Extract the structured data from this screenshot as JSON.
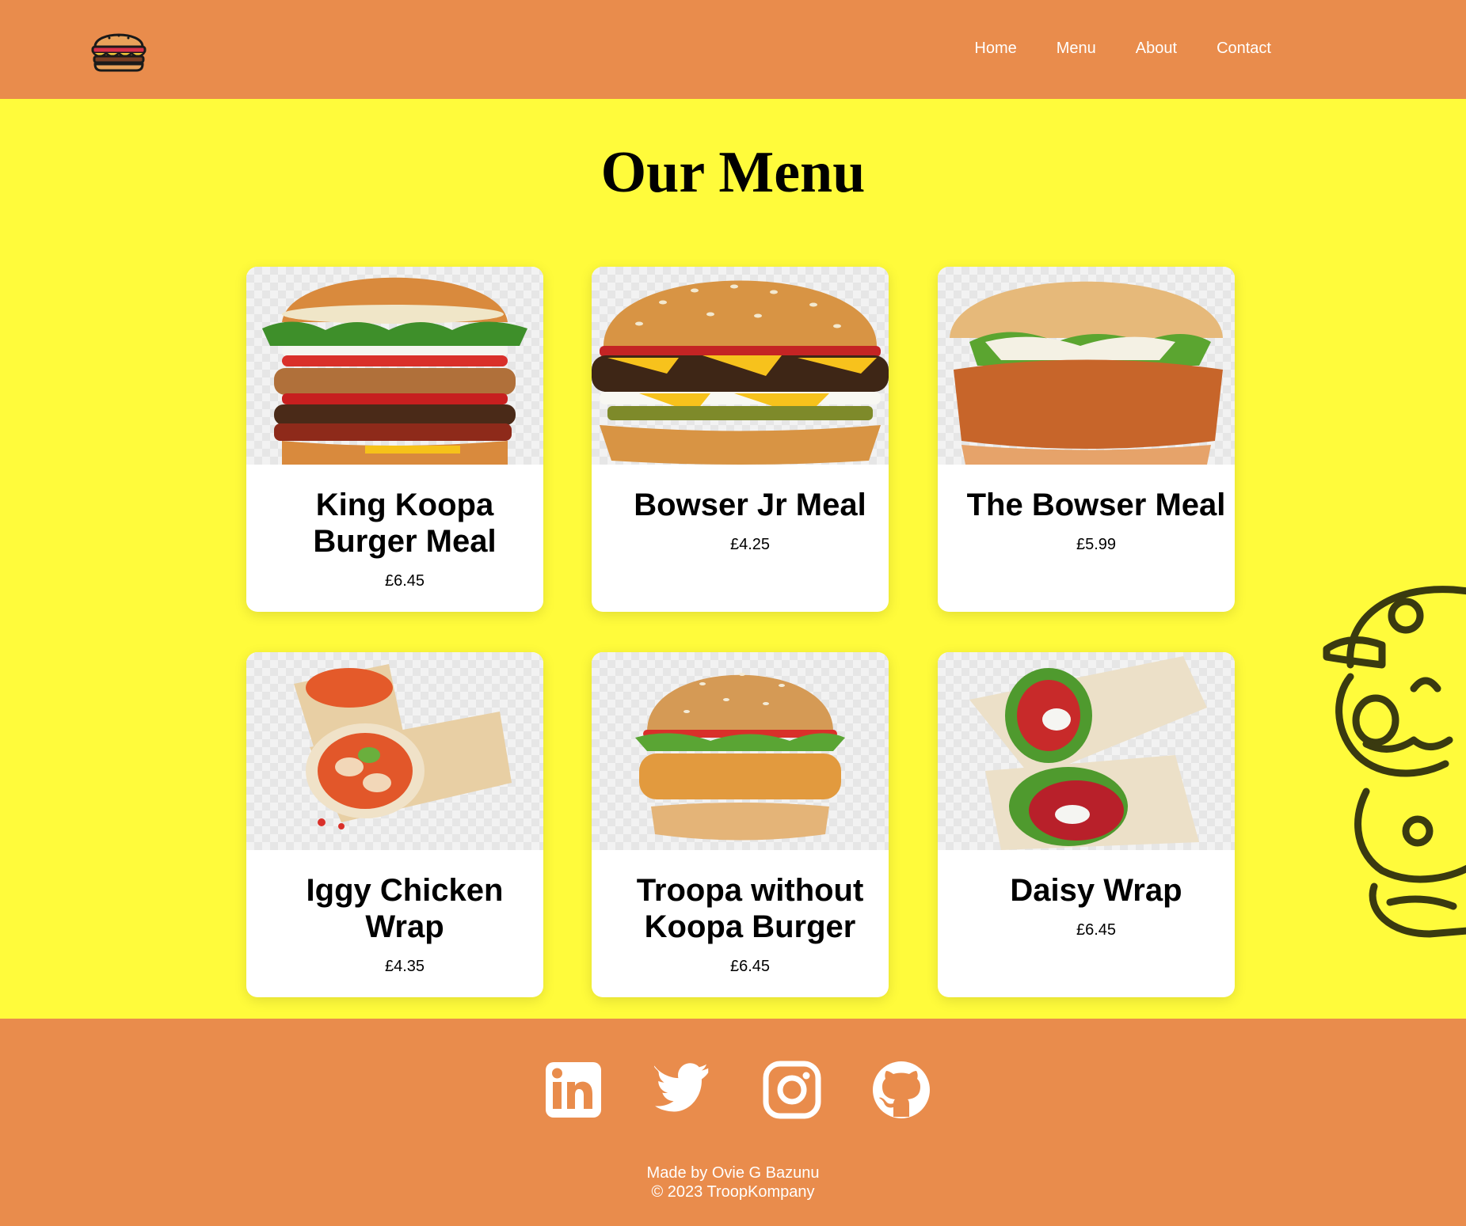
{
  "header": {
    "logo_icon": "burger-icon",
    "nav": [
      {
        "label": "Home"
      },
      {
        "label": "Menu"
      },
      {
        "label": "About"
      },
      {
        "label": "Contact"
      }
    ]
  },
  "main": {
    "title": "Our Menu",
    "items": [
      {
        "name": "King Koopa Burger Meal",
        "price": "£6.45",
        "image": "stacked-burger-image"
      },
      {
        "name": "Bowser Jr Meal",
        "price": "£4.25",
        "image": "cheeseburger-image"
      },
      {
        "name": "The Bowser Meal",
        "price": "£5.99",
        "image": "chicken-burger-image"
      },
      {
        "name": "Iggy Chicken Wrap",
        "price": "£4.35",
        "image": "chicken-wrap-image"
      },
      {
        "name": "Troopa without Koopa Burger",
        "price": "£6.45",
        "image": "veggie-burger-image"
      },
      {
        "name": "Daisy Wrap",
        "price": "£6.45",
        "image": "salad-wrap-image"
      }
    ],
    "decoration": "mario-outline-illustration"
  },
  "footer": {
    "social": [
      "linkedin-icon",
      "twitter-icon",
      "instagram-icon",
      "github-icon"
    ],
    "credit_line1": "Made by Ovie G Bazunu",
    "credit_line2": "© 2023 TroopKompany"
  },
  "colors": {
    "header_bg": "#E98C4C",
    "page_bg": "#FFFB3B",
    "card_bg": "#FFFFFF",
    "text": "#000000",
    "footer_text": "#FFFFFF"
  }
}
